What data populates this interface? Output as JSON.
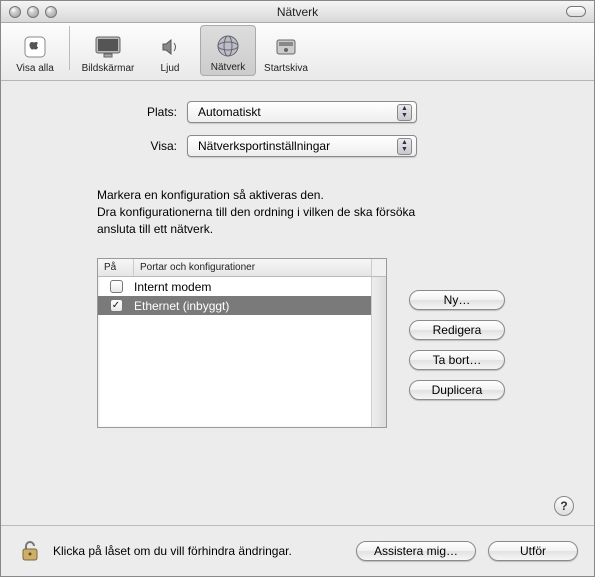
{
  "window": {
    "title": "Nätverk"
  },
  "toolbar": {
    "show_all": "Visa alla",
    "displays": "Bildskärmar",
    "sound": "Ljud",
    "network": "Nätverk",
    "startup_disk": "Startskiva"
  },
  "labels": {
    "location": "Plats:",
    "show": "Visa:"
  },
  "selects": {
    "location_value": "Automatiskt",
    "show_value": "Nätverksportinställningar"
  },
  "instructions": {
    "line1": "Markera en konfiguration så aktiveras den.",
    "line2": "Dra konfigurationerna till den ordning i vilken de ska försöka",
    "line3": "ansluta till ett nätverk."
  },
  "list": {
    "col_on": "På",
    "col_ports": "Portar och konfigurationer",
    "rows": [
      {
        "checked": false,
        "name": "Internt modem",
        "selected": false
      },
      {
        "checked": true,
        "name": "Ethernet (inbyggt)",
        "selected": true
      }
    ]
  },
  "buttons": {
    "new": "Ny…",
    "edit": "Redigera",
    "delete": "Ta bort…",
    "duplicate": "Duplicera",
    "help": "?",
    "assist": "Assistera mig…",
    "apply": "Utför"
  },
  "footer": {
    "lock_text": "Klicka på låset om du vill förhindra ändringar."
  }
}
